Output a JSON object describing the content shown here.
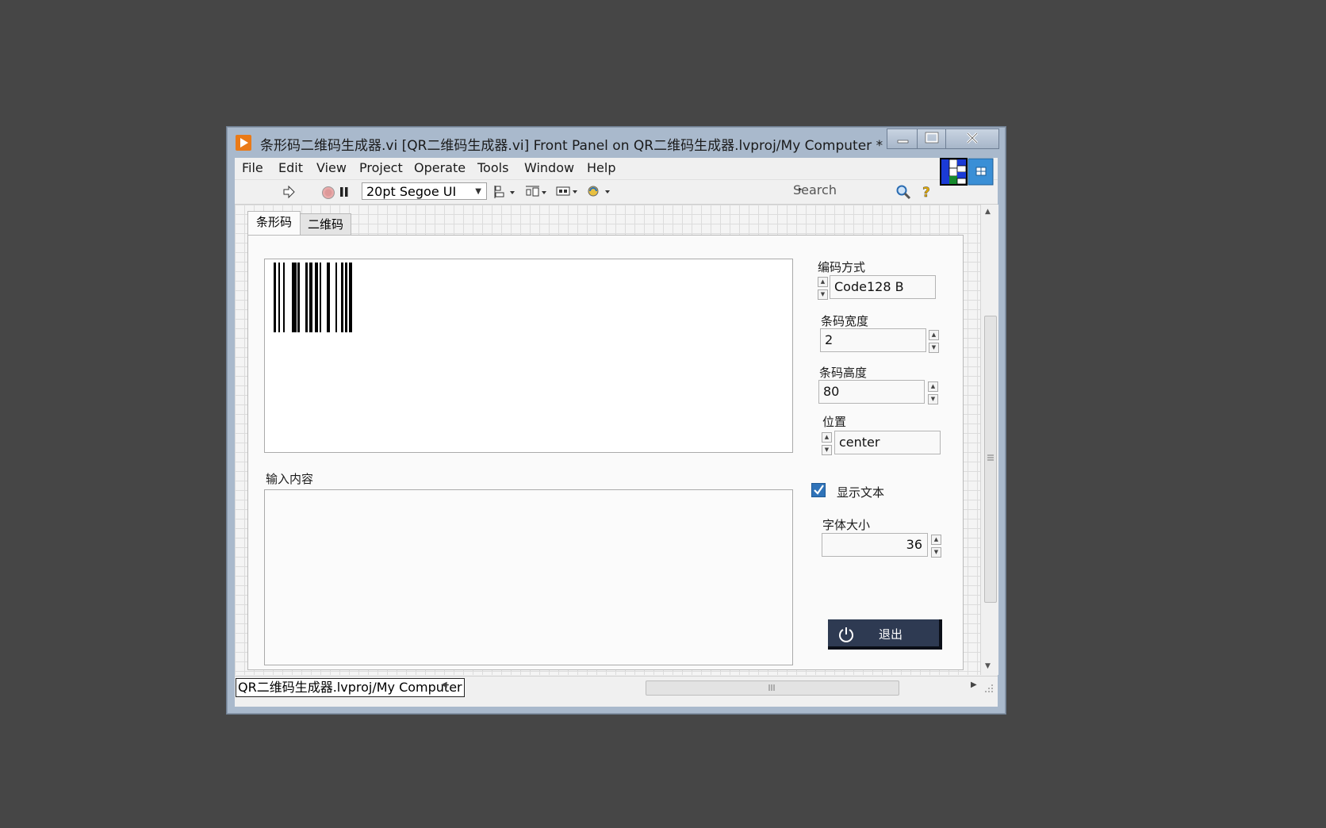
{
  "window": {
    "title": "条形码二维码生成器.vi [QR二维码生成器.vi] Front Panel on QR二维码生成器.lvproj/My Computer *"
  },
  "menu": [
    "File",
    "Edit",
    "View",
    "Project",
    "Operate",
    "Tools",
    "Window",
    "Help"
  ],
  "toolbar": {
    "font": "20pt Segoe UI",
    "search_placeholder": "Search"
  },
  "tabs": [
    "条形码",
    "二维码"
  ],
  "barcode_panel": {
    "input_label": "输入内容",
    "input_value": ""
  },
  "controls": {
    "encoding": {
      "label": "编码方式",
      "value": "Code128 B"
    },
    "bar_width": {
      "label": "条码宽度",
      "value": "2"
    },
    "bar_height": {
      "label": "条码高度",
      "value": "80"
    },
    "position": {
      "label": "位置",
      "value": "center"
    },
    "show_text": {
      "label": "显示文本",
      "checked": true
    },
    "font_size": {
      "label": "字体大小",
      "value": "36"
    }
  },
  "quit_button": {
    "label": "退出"
  },
  "status": {
    "path": "QR二维码生成器.lvproj/My Computer"
  },
  "colors": {
    "accent": "#2f73b9",
    "quit_bg": "#2e3a52",
    "title_icon": "#ea7a17"
  }
}
